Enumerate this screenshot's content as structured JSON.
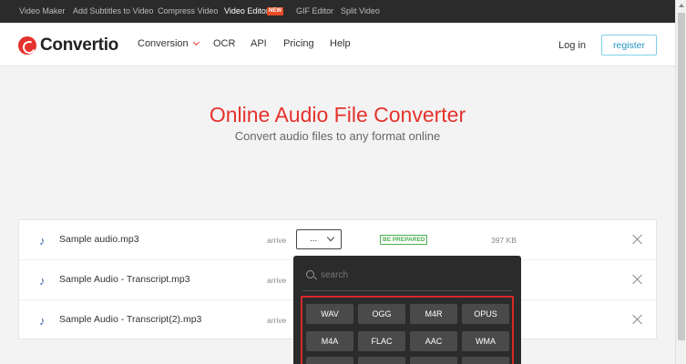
{
  "topbar": {
    "tools": [
      "Video Maker",
      "Add Subtitles to Video",
      "Compress Video",
      "Video Editor",
      "GIF Editor",
      "Split Video"
    ],
    "new_badge": "NEW"
  },
  "nav": {
    "logo": "Convertio",
    "items": [
      "Conversion",
      "OCR",
      "API",
      "Pricing",
      "Help"
    ],
    "login": "Log in",
    "register": "register"
  },
  "hero": {
    "title": "Online Audio File Converter",
    "subtitle": "Convert audio files to any format online"
  },
  "files": [
    {
      "name": "Sample audio.mp3",
      "arrive": "arrive",
      "format": "...",
      "status": "BE PREPARED",
      "size": "397 KB"
    },
    {
      "name": "Sample Audio - Transcript.mp3",
      "arrive": "arrive"
    },
    {
      "name": "Sample Audio - Transcript(2).mp3",
      "arrive": "arrive"
    }
  ],
  "dropdown": {
    "search_placeholder": "search",
    "formats": [
      "WAV",
      "OGG",
      "M4R",
      "OPUS",
      "M4A",
      "FLAC",
      "AAC",
      "WMA"
    ]
  },
  "colors": {
    "brand_red": "#e5322d",
    "topbar_bg": "#2b2b2b",
    "status_green": "#4caf50",
    "register_blue": "#2196c4"
  }
}
